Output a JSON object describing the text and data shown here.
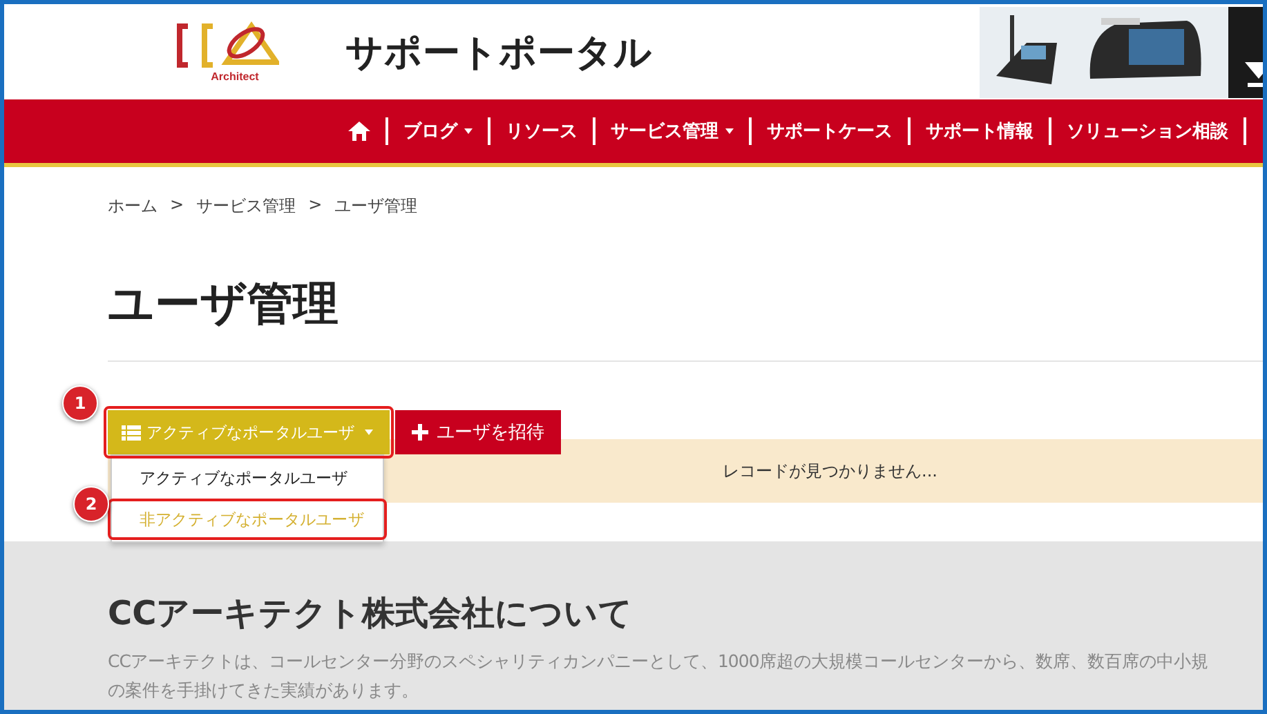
{
  "header": {
    "logo_text": "Architect",
    "site_title": "サポートポータル"
  },
  "nav": [
    {
      "kind": "home"
    },
    {
      "kind": "link",
      "label": "ブログ",
      "dropdown": true
    },
    {
      "kind": "link",
      "label": "リソース",
      "dropdown": false
    },
    {
      "kind": "link",
      "label": "サービス管理",
      "dropdown": true
    },
    {
      "kind": "link",
      "label": "サポートケース",
      "dropdown": false
    },
    {
      "kind": "link",
      "label": "サポート情報",
      "dropdown": false
    },
    {
      "kind": "link",
      "label": "ソリューション相談",
      "dropdown": false
    }
  ],
  "breadcrumb": [
    {
      "label": "ホーム"
    },
    {
      "label": "サービス管理"
    },
    {
      "label": "ユーザ管理"
    }
  ],
  "breadcrumb_separator": ">",
  "page_title": "ユーザ管理",
  "filter_button": {
    "label": "アクティブなポータルユーザ",
    "expanded": true
  },
  "invite_button": {
    "label": "ユーザを招待"
  },
  "filter_menu": [
    {
      "label": "アクティブなポータルユーザ",
      "selected": false
    },
    {
      "label": "非アクティブなポータルユーザ",
      "selected": true
    }
  ],
  "empty_message": "レコードが見つかりません...",
  "about": {
    "heading": "CCアーキテクト株式会社について",
    "lines": [
      "CCアーキテクトは、コールセンター分野のスペシャリティカンパニーとして、1000席超の大規模コールセンターから、数席、数百席の中小規",
      "の案件を手掛けてきた実績があります。"
    ]
  },
  "annotations": [
    {
      "number": "1"
    },
    {
      "number": "2"
    }
  ]
}
